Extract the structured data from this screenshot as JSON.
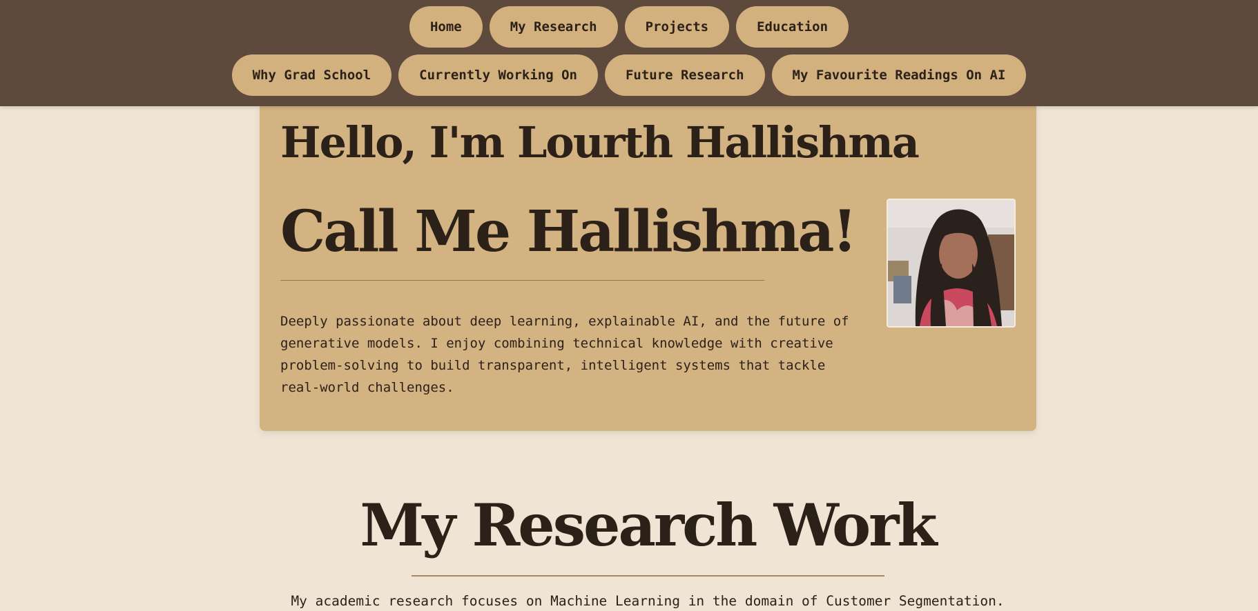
{
  "nav": {
    "row1": [
      {
        "label": "Home"
      },
      {
        "label": "My Research"
      },
      {
        "label": "Projects"
      },
      {
        "label": "Education"
      }
    ],
    "row2": [
      {
        "label": "Why Grad School"
      },
      {
        "label": "Currently Working On"
      },
      {
        "label": "Future Research"
      },
      {
        "label": "My Favourite Readings On AI"
      }
    ]
  },
  "hero": {
    "greeting": "Hello, I'm Lourth Hallishma",
    "nickname": "Call Me Hallishma!",
    "description": "Deeply passionate about deep learning, explainable AI, and the future of generative models. I enjoy combining technical knowledge with creative problem-solving to build transparent, intelligent systems that tackle real-world challenges."
  },
  "research": {
    "title": "My Research Work",
    "description": "My academic research focuses on Machine Learning in the domain of Customer Segmentation."
  },
  "colors": {
    "nav_background": "#5d4a3d",
    "pill": "#d3b17f",
    "card": "#d4b382",
    "page_background": "#f0e5d4",
    "text": "#2b2118"
  }
}
